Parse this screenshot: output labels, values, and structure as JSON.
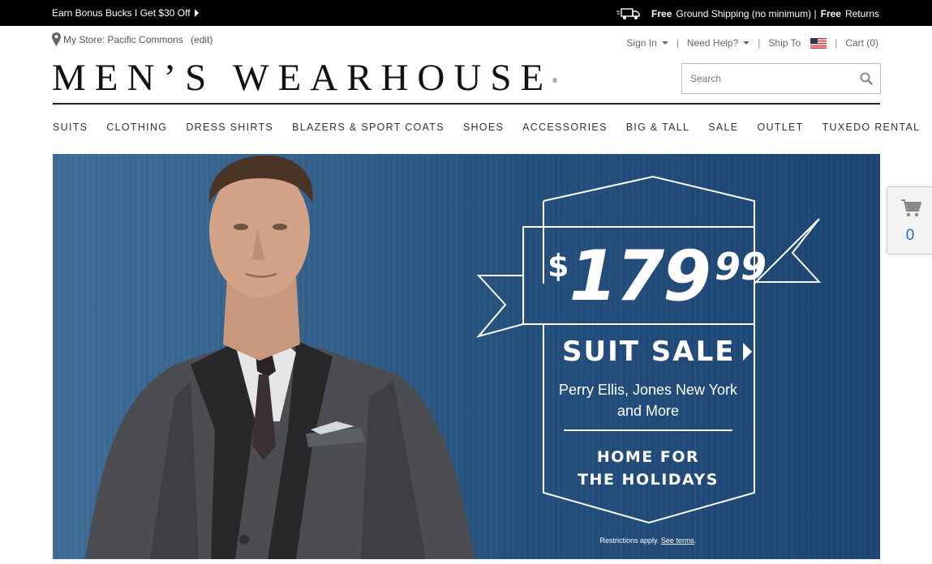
{
  "topbar": {
    "promo": "Earn Bonus Bucks I Get $30 Off",
    "ship_free1": "Free",
    "ship_text": "Ground Shipping (no minimum) |",
    "ship_free2": "Free",
    "ship_returns": "Returns"
  },
  "utility": {
    "store_prefix": "My Store:",
    "store_name": "Pacific Commons",
    "store_edit": "(edit)",
    "sign_in": "Sign In",
    "need_help": "Need Help?",
    "ship_to": "Ship To",
    "cart": "Cart (0)",
    "separator": "|"
  },
  "logo": {
    "text": "MEN’S WEARHOUSE",
    "mark": "®"
  },
  "search": {
    "placeholder": "Search"
  },
  "nav": [
    "SUITS",
    "CLOTHING",
    "DRESS SHIRTS",
    "BLAZERS & SPORT COATS",
    "SHOES",
    "ACCESSORIES",
    "BIG & TALL",
    "SALE",
    "OUTLET",
    "TUXEDO RENTAL"
  ],
  "hero": {
    "price_currency": "$",
    "price_whole": "179",
    "price_cents": "99",
    "headline": "SUIT SALE",
    "brands_line1": "Perry Ellis, Jones New York",
    "brands_line2": "and More",
    "holiday_line1": "HOME FOR",
    "holiday_line2": "THE HOLIDAYS",
    "restrictions": "Restrictions apply.",
    "terms": "See terms",
    "restrictions_end": "."
  },
  "floating_cart": {
    "count": "0"
  },
  "colors": {
    "topbar": "#000000",
    "hero_blue": "#234e7c",
    "cart_count": "#2a6fb5"
  }
}
